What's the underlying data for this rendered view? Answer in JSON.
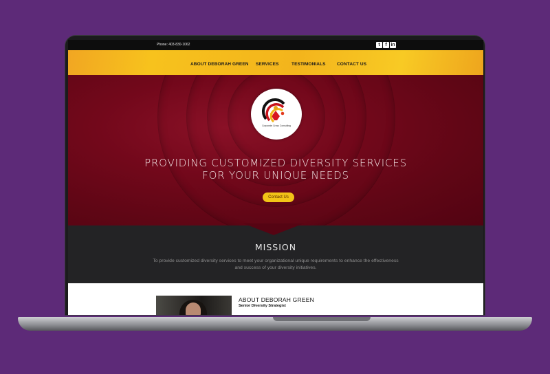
{
  "topbar": {
    "phone": "Phone: 403-830-1062",
    "social": [
      {
        "icon": "twitter-icon",
        "glyph": "t"
      },
      {
        "icon": "facebook-icon",
        "glyph": "f"
      },
      {
        "icon": "linkedin-icon",
        "glyph": "in"
      }
    ]
  },
  "nav": {
    "items": [
      "ABOUT DEBORAH GREEN",
      "SERVICES",
      "TESTIMONIALS",
      "CONTACT US"
    ]
  },
  "logo": {
    "tagline": "Corporate Cross Consulting"
  },
  "hero": {
    "line1": "PROVIDING CUSTOMIZED DIVERSITY SERVICES",
    "line2": "FOR YOUR UNIQUE NEEDS",
    "cta": "Contact Us"
  },
  "mission": {
    "title": "MISSION",
    "text": "To provide customized diversity services to meet your organizational unique requirements to enhance the effectiveness and success of your diversity initiatives."
  },
  "about": {
    "title": "ABOUT DEBORAH GREEN",
    "subtitle": "Senior Diversity Strategist"
  },
  "colors": {
    "background": "#5d2a78",
    "accent": "#f7c21d",
    "hero": "#73081b",
    "dark": "#232325"
  }
}
